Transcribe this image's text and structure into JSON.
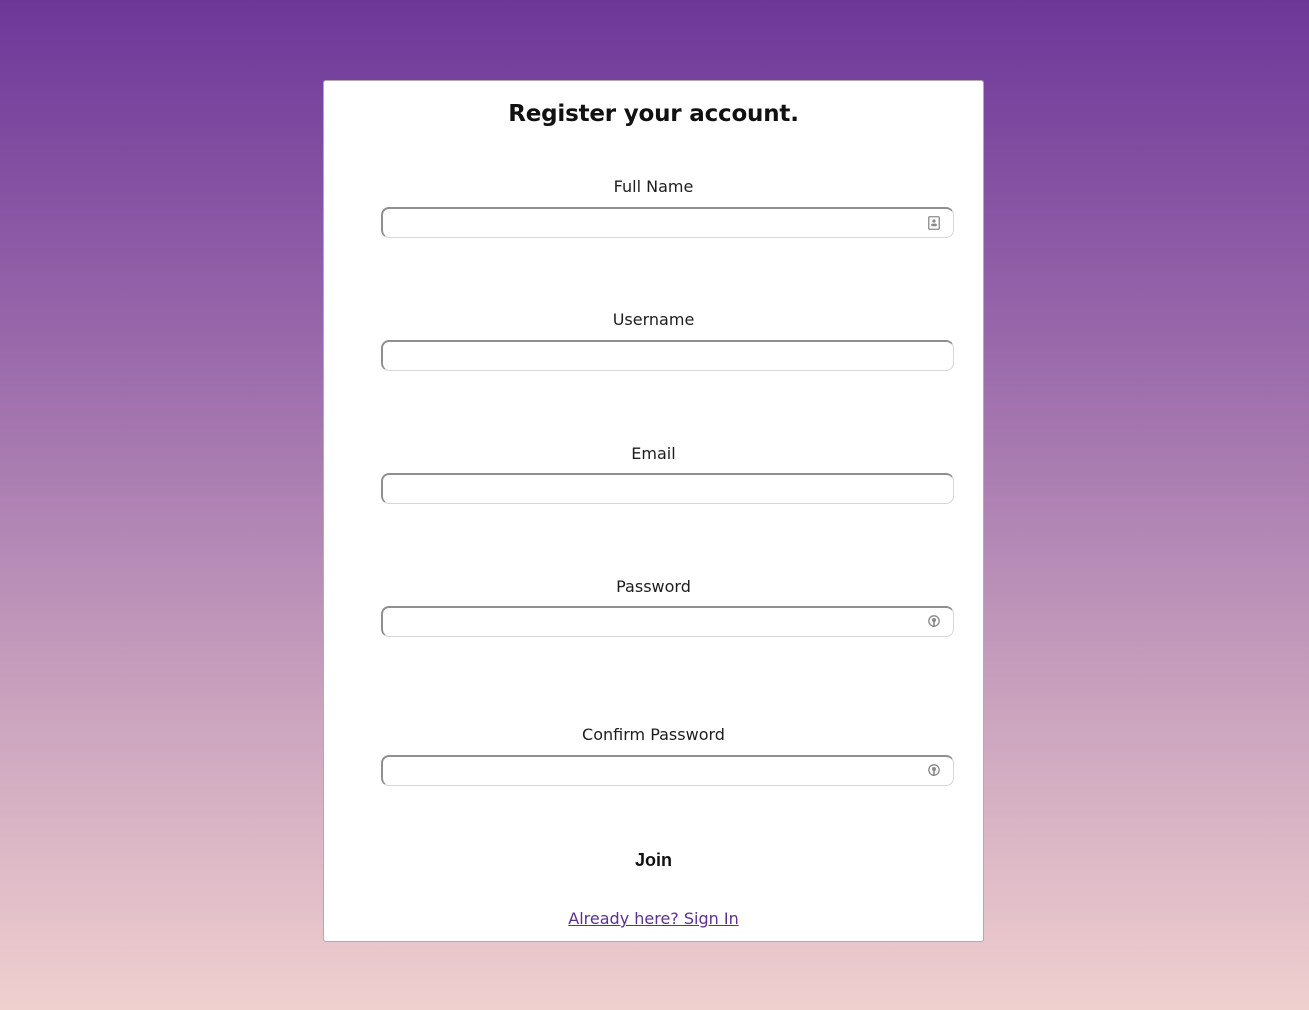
{
  "form": {
    "title": "Register your account.",
    "fields": [
      {
        "label": "Full Name",
        "value": "",
        "icon": "contact-card-icon"
      },
      {
        "label": "Username",
        "value": ""
      },
      {
        "label": "Email",
        "value": ""
      },
      {
        "label": "Password",
        "value": "",
        "icon": "password-key-icon"
      },
      {
        "label": "Confirm Password",
        "value": "",
        "icon": "password-key-icon"
      }
    ],
    "submit_label": "Join",
    "signin_link": "Already here? Sign In"
  },
  "colors": {
    "gradient_top": "#6d3799",
    "gradient_bottom": "#f0d0cf",
    "link": "#5d2f8e"
  }
}
